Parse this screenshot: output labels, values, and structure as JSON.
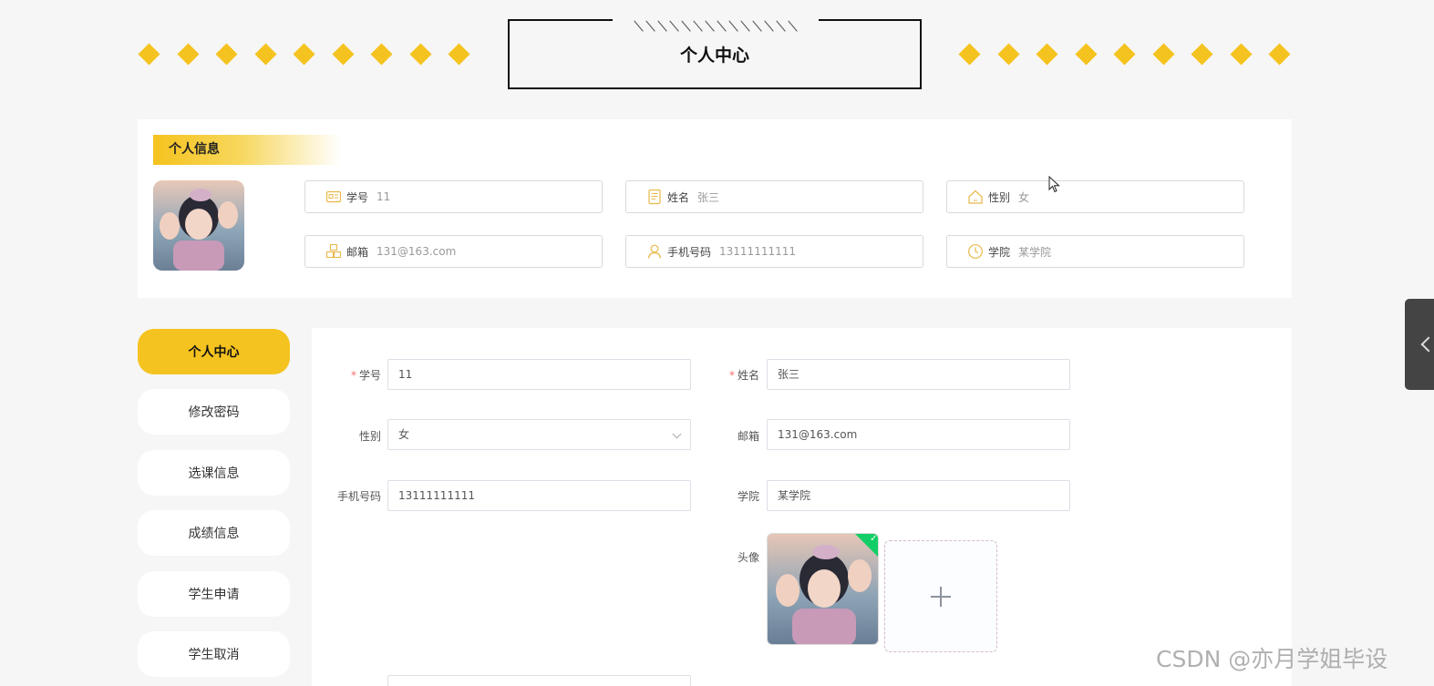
{
  "header": {
    "title": "个人中心",
    "diamond_count_left": 9,
    "diamond_count_right": 9,
    "accent_color": "#f5c31f"
  },
  "info": {
    "section_title": "个人信息",
    "fields": [
      {
        "label": "学号",
        "value": "11",
        "icon": "id-card-icon"
      },
      {
        "label": "姓名",
        "value": "张三",
        "icon": "document-icon"
      },
      {
        "label": "性别",
        "value": "女",
        "icon": "home-icon"
      },
      {
        "label": "邮箱",
        "value": "131@163.com",
        "icon": "boxes-icon"
      },
      {
        "label": "手机号码",
        "value": "13111111111",
        "icon": "user-icon"
      },
      {
        "label": "学院",
        "value": "某学院",
        "icon": "clock-icon"
      }
    ]
  },
  "menu": {
    "items": [
      {
        "label": "个人中心",
        "active": true
      },
      {
        "label": "修改密码",
        "active": false
      },
      {
        "label": "选课信息",
        "active": false
      },
      {
        "label": "成绩信息",
        "active": false
      },
      {
        "label": "学生申请",
        "active": false
      },
      {
        "label": "学生取消",
        "active": false
      }
    ]
  },
  "form": {
    "student_id": {
      "label": "学号",
      "value": "11",
      "required": "*"
    },
    "name": {
      "label": "姓名",
      "value": "张三",
      "required": "*"
    },
    "gender": {
      "label": "性别",
      "value": "女"
    },
    "email": {
      "label": "邮箱",
      "value": "131@163.com"
    },
    "phone": {
      "label": "手机号码",
      "value": "13111111111"
    },
    "college": {
      "label": "学院",
      "value": "某学院"
    },
    "avatar": {
      "label": "头像"
    }
  },
  "watermark": "CSDN @亦月学姐毕设"
}
